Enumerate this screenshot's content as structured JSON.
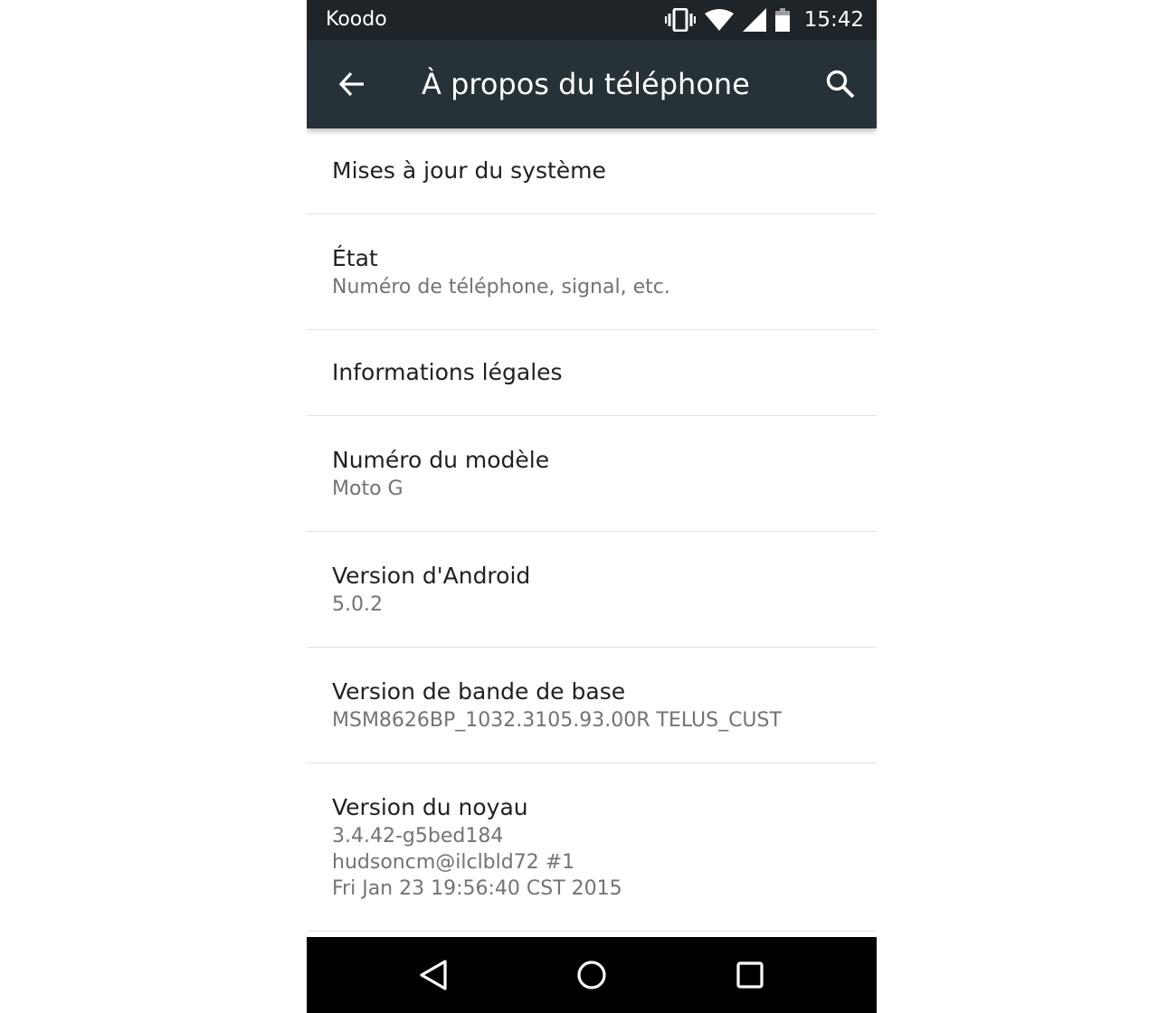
{
  "status_bar": {
    "carrier": "Koodo",
    "time": "15:42",
    "icons": [
      "vibrate-icon",
      "wifi-icon",
      "cell-signal-icon",
      "battery-icon"
    ]
  },
  "app_bar": {
    "title": "À propos du téléphone",
    "back_icon": "arrow-back-icon",
    "search_icon": "search-icon",
    "background": "#263238"
  },
  "settings": {
    "items": [
      {
        "title": "Mises à jour du système"
      },
      {
        "title": "État",
        "summary": "Numéro de téléphone, signal, etc."
      },
      {
        "title": "Informations légales"
      },
      {
        "title": "Numéro du modèle",
        "summary": "Moto G"
      },
      {
        "title": "Version d'Android",
        "summary": "5.0.2"
      },
      {
        "title": "Version de bande de base",
        "summary": "MSM8626BP_1032.3105.93.00R TELUS_CUST"
      },
      {
        "title": "Version du noyau",
        "summary_lines": [
          "3.4.42-g5bed184",
          "hudsoncm@ilclbld72 #1",
          "Fri Jan 23 19:56:40 CST 2015"
        ]
      }
    ]
  },
  "nav_bar": {
    "icons": [
      "back-triangle-icon",
      "home-circle-icon",
      "recents-square-icon"
    ]
  }
}
